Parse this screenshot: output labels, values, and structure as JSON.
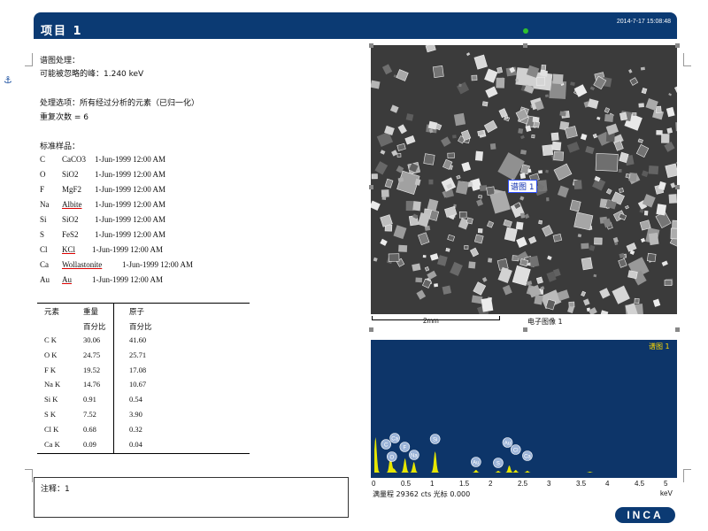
{
  "header": {
    "title": "项目 1",
    "date": "2014-7-17 15:08:48"
  },
  "info": {
    "line1": "谱图处理：",
    "line2": "可能被忽略的峰：1.240 keV",
    "line3": "处理选项：所有经过分析的元素（已归一化）",
    "line4": "重复次数 = 6",
    "line5": "标准样品："
  },
  "standards": [
    {
      "el": "C",
      "std": "CaCO3",
      "date": "1-Jun-1999 12:00 AM"
    },
    {
      "el": "O",
      "std": "SiO2",
      "date": "1-Jun-1999 12:00 AM"
    },
    {
      "el": "F",
      "std": "MgF2",
      "date": "1-Jun-1999 12:00 AM"
    },
    {
      "el": "Na",
      "std": "Albite",
      "date": "1-Jun-1999 12:00 AM"
    },
    {
      "el": "Si",
      "std": "SiO2",
      "date": "1-Jun-1999 12:00 AM"
    },
    {
      "el": "S",
      "std": "FeS2",
      "date": "1-Jun-1999 12:00 AM"
    },
    {
      "el": "Cl",
      "std": "KCl",
      "date": "1-Jun-1999 12:00 AM"
    },
    {
      "el": "Ca",
      "std": "Wollastonite",
      "date": "1-Jun-1999 12:00 AM"
    },
    {
      "el": "Au",
      "std": "Au",
      "date": "1-Jun-1999 12:00 AM"
    }
  ],
  "table": {
    "h1": "元素",
    "h2": "重量",
    "h3": "原子",
    "h2b": "百分比",
    "h3b": "百分比",
    "rows": [
      {
        "el": "C K",
        "wt": "30.06",
        "at": "41.60"
      },
      {
        "el": "O K",
        "wt": "24.75",
        "at": "25.71"
      },
      {
        "el": "F K",
        "wt": "19.52",
        "at": "17.08"
      },
      {
        "el": "Na K",
        "wt": "14.76",
        "at": "10.67"
      },
      {
        "el": "Si K",
        "wt": "0.91",
        "at": "0.54"
      },
      {
        "el": "S K",
        "wt": "7.52",
        "at": "3.90"
      },
      {
        "el": "Cl K",
        "wt": "0.68",
        "at": "0.32"
      },
      {
        "el": "Ca K",
        "wt": "0.09",
        "at": "0.04"
      }
    ]
  },
  "note": "注释：1",
  "image": {
    "label": "谱图 1",
    "scale": "2mm",
    "caption": "电子图像 1"
  },
  "spectrum": {
    "title": "谱图 1",
    "peaks": [
      "C",
      "O",
      "Ca",
      "F",
      "Na",
      "Si",
      "Au",
      "S",
      "Au",
      "Cl",
      "Ca"
    ],
    "ticks": [
      "0",
      "0.5",
      "1",
      "1.5",
      "2",
      "2.5",
      "3",
      "3.5",
      "4",
      "4.5",
      "5"
    ],
    "unit": "keV",
    "footer": "满量程 29362 cts 光标 0.000"
  },
  "logo": "INCA",
  "colors": {
    "header": "#0b3a73",
    "spectrum_bg": "#0d3569",
    "peak": "#e6e600",
    "title": "#ffdc00"
  }
}
